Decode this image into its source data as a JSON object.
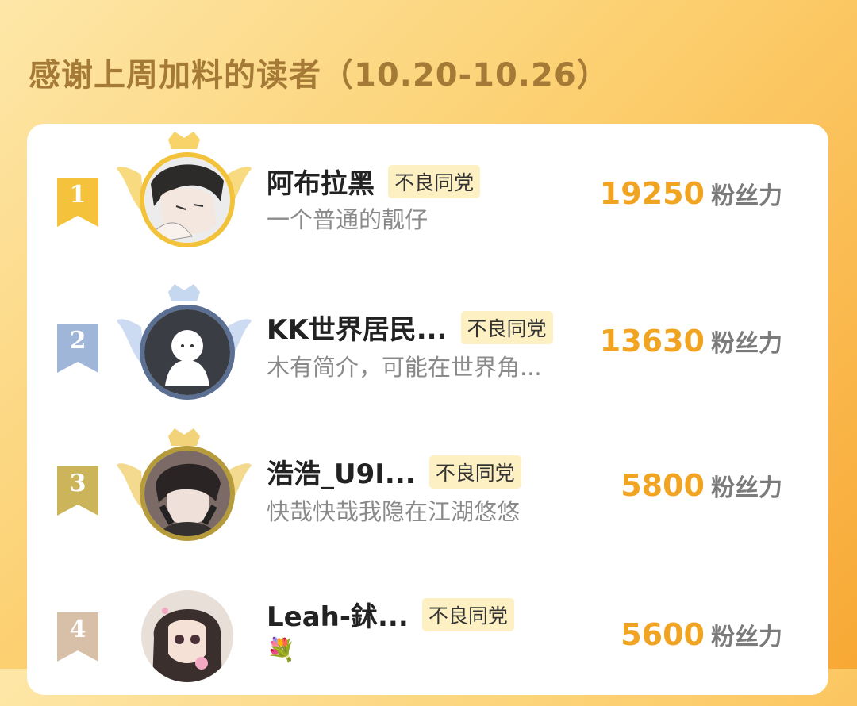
{
  "header": {
    "title": "感谢上周加料的读者（10.20-10.26）"
  },
  "readers": [
    {
      "rank": "1",
      "name": "阿布拉黑",
      "tag": "不良同党",
      "bio": "一个普通的靓仔",
      "score": "19250",
      "unit": "粉丝力",
      "badge_color": "#f4c23b"
    },
    {
      "rank": "2",
      "name": "KK世界居民...",
      "tag": "不良同党",
      "bio": "木有简介，可能在世界角...",
      "score": "13630",
      "unit": "粉丝力",
      "badge_color": "#9fb6d9"
    },
    {
      "rank": "3",
      "name": "浩浩_U9I...",
      "tag": "不良同党",
      "bio": "快哉快哉我隐在江湖悠悠",
      "score": "5800",
      "unit": "粉丝力",
      "badge_color": "#cbb45a"
    },
    {
      "rank": "4",
      "name": "Leah-鉥...",
      "tag": "不良同党",
      "bio": "💐",
      "score": "5600",
      "unit": "粉丝力",
      "badge_color": "#d8bfa8"
    }
  ],
  "colors": {
    "accent": "#f0a422",
    "title": "#a47a36",
    "tag_bg": "#fdf0c3"
  }
}
